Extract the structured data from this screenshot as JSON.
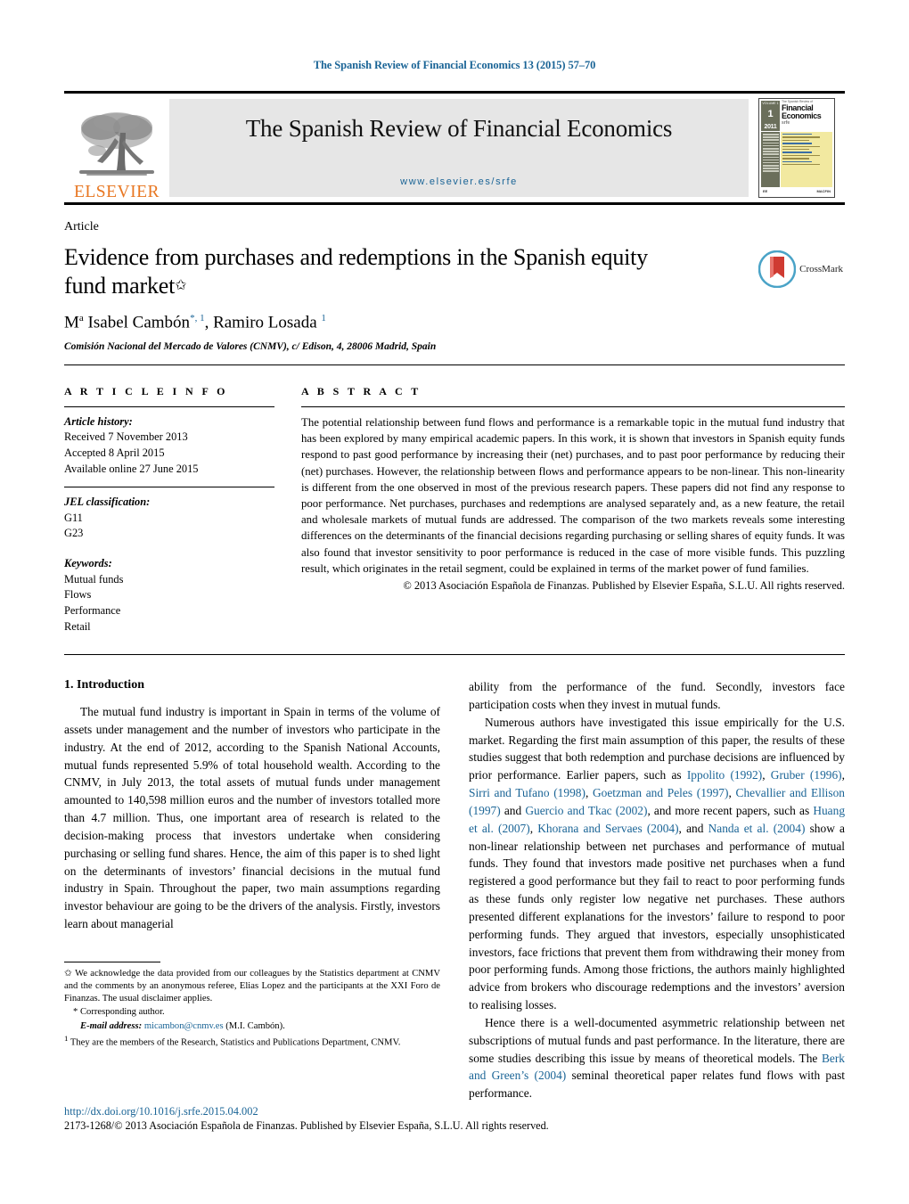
{
  "running_head": "The Spanish Review of Financial Economics 13  (2015) 57–70",
  "masthead": {
    "publisher_name": "ELSEVIER",
    "publisher_logo": "elsevier-tree-logo",
    "journal_title": "The Spanish Review of Financial Economics",
    "journal_url": "www.elsevier.es/srfe",
    "cover": {
      "issue_number": "1",
      "volume_label": "VOLUME 1",
      "issue_label": "ISSUE 1",
      "year": "2011",
      "line1": "The Spanish Review of",
      "line2": "Financial",
      "line3": "Economics",
      "abbrev": "srfe",
      "footer_left": "EE",
      "footer_right": "MACFIN"
    }
  },
  "article": {
    "type": "Article",
    "title": "Evidence from purchases and redemptions in the Spanish equity fund market",
    "title_marker": "✩",
    "crossmark_label": "CrossMark",
    "authors_html": "M<sup>a</sup> Isabel Cambón<sup class=\"star\">*</sup><sup class=\"fn\">, 1</sup>, Ramiro Losada <sup class=\"fn\">1</sup>",
    "affiliation": "Comisión Nacional del Mercado de Valores (CNMV), c/ Edison, 4, 28006 Madrid, Spain"
  },
  "article_info": {
    "heading": "A R T I C L E   I N F O",
    "history_label": "Article history:",
    "history": [
      "Received 7 November 2013",
      "Accepted 8 April 2015",
      "Available online 27 June 2015"
    ],
    "jel_label": "JEL classification:",
    "jel_codes": [
      "G11",
      "G23"
    ],
    "keywords_label": "Keywords:",
    "keywords": [
      "Mutual funds",
      "Flows",
      "Performance",
      "Retail"
    ]
  },
  "abstract": {
    "heading": "A B S T R A C T",
    "text": "The potential relationship between fund flows and performance is a remarkable topic in the mutual fund industry that has been explored by many empirical academic papers. In this work, it is shown that investors in Spanish equity funds respond to past good performance by increasing their (net) purchases, and to past poor performance by reducing their (net) purchases. However, the relationship between flows and performance appears to be non-linear. This non-linearity is different from the one observed in most of the previous research papers. These papers did not find any response to poor performance. Net purchases, purchases and redemptions are analysed separately and, as a new feature, the retail and wholesale markets of mutual funds are addressed. The comparison of the two markets reveals some interesting differences on the determinants of the financial decisions regarding purchasing or selling shares of equity funds. It was also found that investor sensitivity to poor performance is reduced in the case of more visible funds. This puzzling result, which originates in the retail segment, could be explained in terms of the market power of fund families.",
    "copyright": "© 2013 Asociación Española de Finanzas. Published by Elsevier España, S.L.U. All rights reserved."
  },
  "body": {
    "section_heading": "1.  Introduction",
    "left_paragraph": "The mutual fund industry is important in Spain in terms of the volume of assets under management and the number of investors who participate in the industry. At the end of 2012, according to the Spanish National Accounts, mutual funds represented 5.9% of total household wealth. According to the CNMV, in July 2013, the total assets of mutual funds under management amounted to 140,598 million euros and the number of investors totalled more than 4.7 million. Thus, one important area of research is related to the decision-making process that investors undertake when considering purchasing or selling fund shares. Hence, the aim of this paper is to shed light on the determinants of investors’ financial decisions in the mutual fund industry in Spain. Throughout the paper, two main assumptions regarding investor behaviour are going to be the drivers of the analysis. Firstly, investors learn about managerial",
    "right_p0": "ability from the performance of the fund. Secondly, investors face participation costs when they invest in mutual funds.",
    "right_p1_pre": "Numerous authors have investigated this issue empirically for the U.S. market. Regarding the first main assumption of this paper, the results of these studies suggest that both redemption and purchase decisions are influenced by prior performance. Earlier papers, such as ",
    "right_p1_refs": [
      "Ippolito (1992)",
      "Gruber (1996)",
      "Sirri and Tufano (1998)",
      "Goetzman and Peles (1997)",
      "Chevallier and Ellison (1997)",
      "Guercio and Tkac (2002)",
      "Huang et al. (2007)",
      "Khorana and Servaes (2004)",
      "Nanda et al. (2004)"
    ],
    "right_p1_post": "show a non-linear relationship between net purchases and performance of mutual funds. They found that investors made positive net purchases when a fund registered a good performance but they fail to react to poor performing funds as these funds only register low negative net purchases. These authors presented different explanations for the investors’ failure to respond to poor performing funds. They argued that investors, especially unsophisticated investors, face frictions that prevent them from withdrawing their money from poor performing funds. Among those frictions, the authors mainly highlighted advice from brokers who discourage redemptions and the investors’ aversion to realising losses.",
    "right_p2_pre": "Hence there is a well-documented asymmetric relationship between net subscriptions of mutual funds and past performance. In the literature, there are some studies describing this issue by means of theoretical models. The ",
    "right_p2_ref": "Berk and Green’s (2004)",
    "right_p2_post": " seminal theoretical paper relates fund flows with past performance."
  },
  "footnotes": {
    "star_marker": "✩",
    "star_text": "We acknowledge the data provided from our colleagues by the Statistics department at CNMV and the comments by an anonymous referee, Elias Lopez and the participants at the XXI Foro de Finanzas. The usual disclaimer applies.",
    "corresponding_marker": "*",
    "corresponding_text": "Corresponding author.",
    "email_label": "E-mail address:",
    "email": "micambon@cnmv.es",
    "email_attrib": "(M.I. Cambón).",
    "one_marker": "1",
    "one_text": "They are the members of the Research, Statistics and Publications Department, CNMV."
  },
  "footer": {
    "doi": "http://dx.doi.org/10.1016/j.srfe.2015.04.002",
    "issn_line": "2173-1268/© 2013 Asociación Española de Finanzas. Published by Elsevier España, S.L.U. All rights reserved."
  },
  "colors": {
    "link": "#1a6496",
    "elsevier_orange": "#E87722",
    "masthead_bg": "#e6e6e6"
  }
}
